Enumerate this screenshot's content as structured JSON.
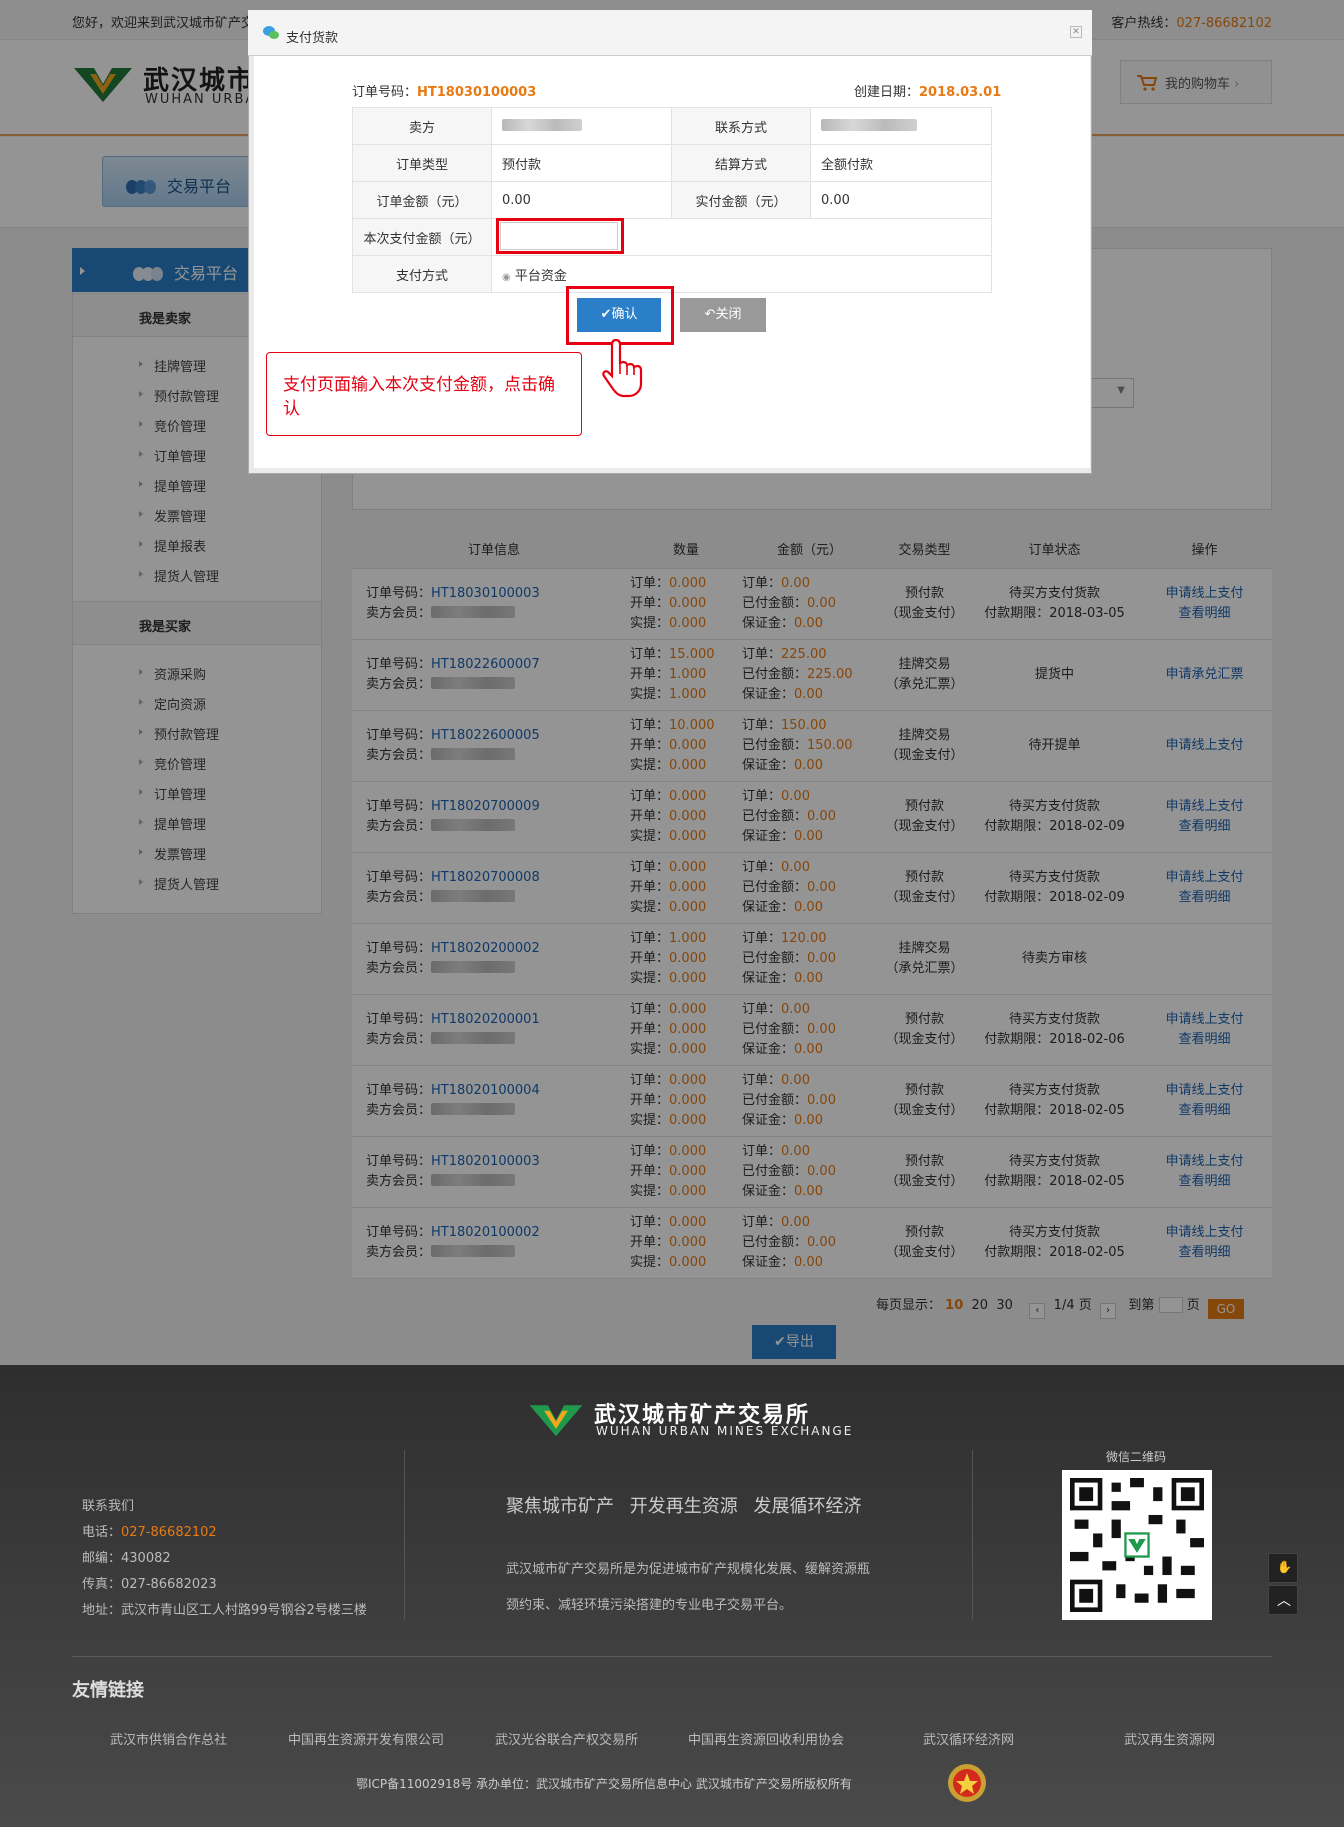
{
  "topbar": {
    "welcome": "您好，欢迎来到武汉城市矿产交易所！",
    "hotline_label": "客户热线：",
    "hotline": "027-86682102"
  },
  "brand": {
    "name_cn": "武汉城市",
    "name_en": "WUHAN URBAN"
  },
  "cart": {
    "label": "我的购物车"
  },
  "nav": {
    "tab": "交易平台"
  },
  "sidebar": {
    "title": "交易平台",
    "seller_title": "我是卖家",
    "seller_items": [
      "挂牌管理",
      "预付款管理",
      "竞价管理",
      "订单管理",
      "提单管理",
      "发票管理",
      "提单报表",
      "提货人管理"
    ],
    "buyer_title": "我是买家",
    "buyer_items": [
      "资源采购",
      "定向资源",
      "预付款管理",
      "竞价管理",
      "订单管理",
      "提单管理",
      "发票管理",
      "提货人管理"
    ]
  },
  "orders": {
    "headers": [
      "订单信息",
      "数量",
      "金额（元）",
      "交易类型",
      "订单状态",
      "操作"
    ],
    "labels": {
      "no": "订单号码：",
      "seller": "卖方会员：",
      "q_order": "订单：",
      "q_open": "开单：",
      "q_real": "实提：",
      "a_order": "订单：",
      "a_paid": "已付金额：",
      "a_deposit": "保证金："
    },
    "rows": [
      {
        "no": "HT18030100003",
        "q": [
          "0.000",
          "0.000",
          "0.000"
        ],
        "a": [
          "0.00",
          "0.00",
          "0.00"
        ],
        "type1": "预付款",
        "type2": "（现金支付）",
        "status1": "待买方支付货款",
        "status2": "付款期限：2018-03-05",
        "op1": "申请线上支付",
        "op2": "查看明细"
      },
      {
        "no": "HT18022600007",
        "q": [
          "15.000",
          "1.000",
          "1.000"
        ],
        "a": [
          "225.00",
          "225.00",
          "0.00"
        ],
        "type1": "挂牌交易",
        "type2": "（承兑汇票）",
        "status1": "提货中",
        "status2": "",
        "op1": "申请承兑汇票",
        "op2": ""
      },
      {
        "no": "HT18022600005",
        "q": [
          "10.000",
          "0.000",
          "0.000"
        ],
        "a": [
          "150.00",
          "150.00",
          "0.00"
        ],
        "type1": "挂牌交易",
        "type2": "（现金支付）",
        "status1": "待开提单",
        "status2": "",
        "op1": "申请线上支付",
        "op2": ""
      },
      {
        "no": "HT18020700009",
        "q": [
          "0.000",
          "0.000",
          "0.000"
        ],
        "a": [
          "0.00",
          "0.00",
          "0.00"
        ],
        "type1": "预付款",
        "type2": "（现金支付）",
        "status1": "待买方支付货款",
        "status2": "付款期限：2018-02-09",
        "op1": "申请线上支付",
        "op2": "查看明细"
      },
      {
        "no": "HT18020700008",
        "q": [
          "0.000",
          "0.000",
          "0.000"
        ],
        "a": [
          "0.00",
          "0.00",
          "0.00"
        ],
        "type1": "预付款",
        "type2": "（现金支付）",
        "status1": "待买方支付货款",
        "status2": "付款期限：2018-02-09",
        "op1": "申请线上支付",
        "op2": "查看明细"
      },
      {
        "no": "HT18020200002",
        "q": [
          "1.000",
          "0.000",
          "0.000"
        ],
        "a": [
          "120.00",
          "0.00",
          "0.00"
        ],
        "type1": "挂牌交易",
        "type2": "（承兑汇票）",
        "status1": "待卖方审核",
        "status2": "",
        "op1": "",
        "op2": ""
      },
      {
        "no": "HT18020200001",
        "q": [
          "0.000",
          "0.000",
          "0.000"
        ],
        "a": [
          "0.00",
          "0.00",
          "0.00"
        ],
        "type1": "预付款",
        "type2": "（现金支付）",
        "status1": "待买方支付货款",
        "status2": "付款期限：2018-02-06",
        "op1": "申请线上支付",
        "op2": "查看明细"
      },
      {
        "no": "HT18020100004",
        "q": [
          "0.000",
          "0.000",
          "0.000"
        ],
        "a": [
          "0.00",
          "0.00",
          "0.00"
        ],
        "type1": "预付款",
        "type2": "（现金支付）",
        "status1": "待买方支付货款",
        "status2": "付款期限：2018-02-05",
        "op1": "申请线上支付",
        "op2": "查看明细"
      },
      {
        "no": "HT18020100003",
        "q": [
          "0.000",
          "0.000",
          "0.000"
        ],
        "a": [
          "0.00",
          "0.00",
          "0.00"
        ],
        "type1": "预付款",
        "type2": "（现金支付）",
        "status1": "待买方支付货款",
        "status2": "付款期限：2018-02-05",
        "op1": "申请线上支付",
        "op2": "查看明细"
      },
      {
        "no": "HT18020100002",
        "q": [
          "0.000",
          "0.000",
          "0.000"
        ],
        "a": [
          "0.00",
          "0.00",
          "0.00"
        ],
        "type1": "预付款",
        "type2": "（现金支付）",
        "status1": "待买方支付货款",
        "status2": "付款期限：2018-02-05",
        "op1": "申请线上支付",
        "op2": "查看明细"
      }
    ]
  },
  "pager": {
    "per_page_label": "每页显示：",
    "sizes": [
      "10",
      "20",
      "30"
    ],
    "page_info": "1/4 页",
    "goto": "到第",
    "page_suffix": "页",
    "go": "GO"
  },
  "export_label": "导出",
  "modal": {
    "title": "支付货款",
    "order_no_label": "订单号码：",
    "order_no": "HT18030100003",
    "date_label": "创建日期：",
    "date": "2018.03.01",
    "seller": "卖方",
    "contact": "联系方式",
    "order_type_label": "订单类型",
    "order_type": "预付款",
    "settle_label": "结算方式",
    "settle": "全额付款",
    "order_amount_label": "订单金额（元）",
    "order_amount": "0.00",
    "paid_amount_label": "实付金额（元）",
    "paid_amount": "0.00",
    "pay_now_label": "本次支付金额（元）",
    "pay_method_label": "支付方式",
    "pay_method": "平台资金",
    "confirm": "确认",
    "close": "关闭",
    "callout": "支付页面输入本次支付金额，点击确认"
  },
  "footer": {
    "name_cn": "武汉城市矿产交易所",
    "name_en": "WUHAN URBAN MINES EXCHANGE",
    "contact_title": "联系我们",
    "phone_label": "电话：",
    "phone": "027-86682102",
    "zip": "邮编：430082",
    "fax": "传真：027-86682023",
    "addr": "地址：武汉市青山区工人村路99号钢谷2号楼三楼",
    "slogan": "聚焦城市矿产  开发再生资源  发展循环经济",
    "desc": "武汉城市矿产交易所是为促进城市矿产规模化发展、缓解资源瓶颈约束、减轻环境污染搭建的专业电子交易平台。",
    "qr_title": "微信二维码",
    "links_title": "友情链接",
    "links": [
      "武汉市供销合作总社",
      "中国再生资源开发有限公司",
      "武汉光谷联合产权交易所",
      "中国再生资源回收利用协会",
      "武汉循环经济网",
      "武汉再生资源网"
    ],
    "copyright": "鄂ICP备11002918号  承办单位：武汉城市矿产交易所信息中心  武汉城市矿产交易所版权所有"
  },
  "colors": {
    "accent": "#2a7fc8",
    "orange": "#e77a12",
    "red": "#e60012"
  }
}
